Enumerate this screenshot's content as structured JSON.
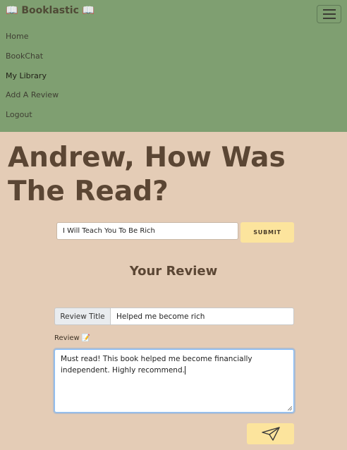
{
  "navbar": {
    "brand_prefix_icon": "📖",
    "brand_text": "Booklastic",
    "brand_suffix_icon": "📖",
    "toggler_icon": "hamburger-menu-icon",
    "links": [
      {
        "label": "Home"
      },
      {
        "label": "BookChat"
      },
      {
        "label": "My Library"
      },
      {
        "label": "Add A Review"
      },
      {
        "label": "Logout"
      }
    ]
  },
  "main": {
    "headline": "Andrew, How Was The Read?",
    "book_search": {
      "value": "I Will Teach You To Be Rich",
      "submit_label": "SUBMIT"
    },
    "section_title": "Your Review",
    "review_title": {
      "addon_label": "Review Title",
      "value": "Helped me become rich"
    },
    "review_body": {
      "label": "Review",
      "label_icon": "📝",
      "value": "Must read! This book helped me become financially independent. Highly recommend."
    },
    "send_icon": "paper-plane-icon"
  },
  "colors": {
    "page_bg": "#e4ccb6",
    "navbar_bg": "#7f9f71",
    "button_bg": "#fce49d",
    "heading_text": "#5b4634"
  }
}
